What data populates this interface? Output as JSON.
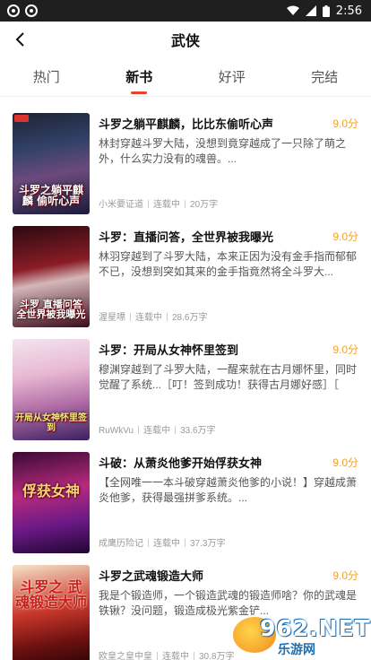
{
  "status_bar": {
    "time": "2:56"
  },
  "header": {
    "title": "武侠"
  },
  "tabs": [
    {
      "label": "热门"
    },
    {
      "label": "新书"
    },
    {
      "label": "好评"
    },
    {
      "label": "完结"
    }
  ],
  "active_tab": "新书",
  "accent_color": "#e5452f",
  "score_color": "#f0a22b",
  "books": [
    {
      "title": "斗罗之躺平麒麟，比比东偷听心声",
      "score": "9.0分",
      "desc": "林封穿越斗罗大陆，没想到竟穿越成了一只除了萌之外，什么实力没有的魂兽。...",
      "author": "小米要证道",
      "status": "连载中",
      "words": "20万字",
      "cover_text": "斗罗之躺平麒麟 偷听心声"
    },
    {
      "title": "斗罗：直播问答，全世界被我曝光",
      "score": "9.0分",
      "desc": "林羽穿越到了斗罗大陆，本来正因为没有金手指而郁郁不已，没想到突如其来的金手指竟然将全斗罗大...",
      "author": "渥星嘌",
      "status": "连载中",
      "words": "28.6万字",
      "cover_text": "斗罗 直播问答 全世界被我曝光"
    },
    {
      "title": "斗罗：开局从女神怀里签到",
      "score": "9.0分",
      "desc": "穆渊穿越到了斗罗大陆，一醒来就在古月娜怀里，同时觉醒了系统...［叮！签到成功！获得古月娜好感］［",
      "author": "RuWkVu",
      "status": "连载中",
      "words": "33.6万字",
      "cover_text": "开局从女神怀里签到"
    },
    {
      "title": "斗破：从萧炎他爹开始俘获女神",
      "score": "9.0分",
      "desc": "【全网唯一一本斗破穿越萧炎他爹的小说！】穿越成萧炎他爹，获得最强拼爹系统。...",
      "author": "成鹰历险记",
      "status": "连载中",
      "words": "37.3万字",
      "cover_text": "俘获女神"
    },
    {
      "title": "斗罗之武魂锻造大师",
      "score": "9.0分",
      "desc": "我是个锻造师，一个锻造武魂的锻造师啥？你的武魂是铁锹？没问题，锻造成极光紫金铲...",
      "author": "欧皇之皇中皇",
      "status": "连载中",
      "words": "30.8万字",
      "cover_text": "斗罗之 武魂锻造大师"
    }
  ],
  "watermark": {
    "number": "962.NET",
    "site": "乐游网"
  }
}
